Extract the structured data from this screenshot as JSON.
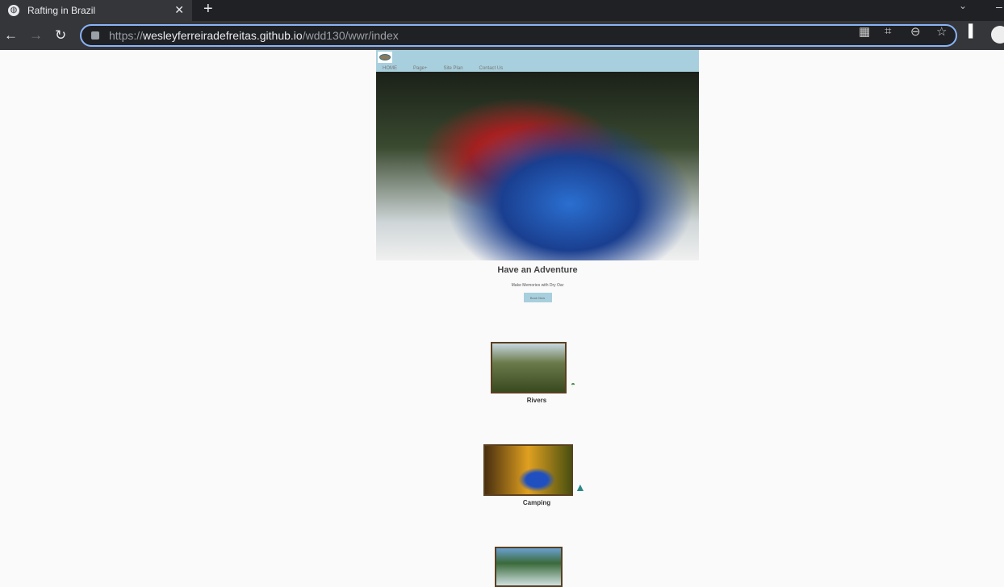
{
  "browser": {
    "tab_title": "Rafting in Brazil",
    "url_prefix": "https://",
    "url_domain": "wesleyferreiradefreitas.github.io",
    "url_path": "/wdd130/wwr/index"
  },
  "nav": {
    "items": [
      "HOME",
      "Page+",
      "Site Plan",
      "Contact Us"
    ]
  },
  "hero": {
    "title": "Have an Adventure",
    "subtitle": "Make Memories with Dry Oar",
    "button": "Book Now"
  },
  "features": [
    {
      "label": "Rivers"
    },
    {
      "label": "Camping"
    }
  ]
}
